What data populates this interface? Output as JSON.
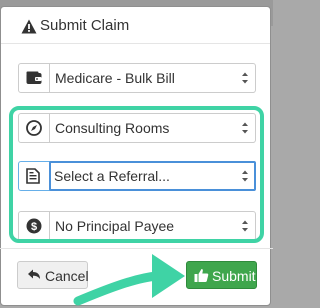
{
  "modal": {
    "title": "Submit Claim",
    "title_icon": "warning-icon"
  },
  "fields": {
    "billing_type": {
      "value": "Medicare - Bulk Bill",
      "icon": "wallet-icon"
    },
    "location": {
      "value": "Consulting Rooms",
      "icon": "compass-icon"
    },
    "referral": {
      "value": "Select a Referral...",
      "icon": "document-icon"
    },
    "payee": {
      "value": "No Principal Payee",
      "icon": "dollar-icon"
    }
  },
  "footer": {
    "cancel_label": "Cancel",
    "submit_label": "Submit"
  },
  "colors": {
    "highlight": "#3fd3a5",
    "submit_bg": "#3fa64d",
    "focus_border": "#4a90d9",
    "arrow": "#3fd3a5"
  }
}
